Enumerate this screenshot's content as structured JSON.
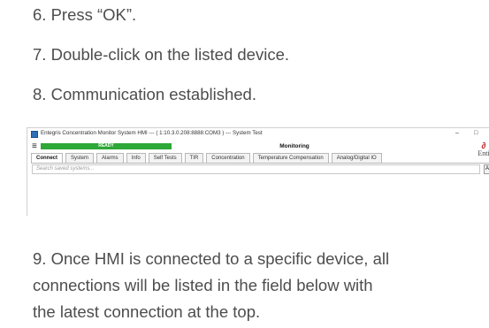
{
  "steps": [
    {
      "number": "6.",
      "text": "Press “OK”."
    },
    {
      "number": "7.",
      "text": "Double-click on the listed device."
    },
    {
      "number": "8.",
      "text": "Communication established."
    },
    {
      "number": "9.",
      "lines": [
        "Once HMI is connected to a specific device, all",
        "connections will be listed in the field below with",
        "the latest connection at the top."
      ]
    }
  ],
  "screenshot": {
    "window_title": "Entegris Concentration Monitor System HMI --- ( 1:10.3.0.208:8888:COM3 ) --- System Test",
    "minimize_glyph": "–",
    "maximize_glyph": "□",
    "menu_glyph": "≡",
    "status": "READY",
    "status_color": "#2ea836",
    "mode": "Monitoring",
    "logo_text": "Enti",
    "logo_color": "#c0272d",
    "tabs": [
      "Connect",
      "System",
      "Alarms",
      "Info",
      "Self Tests",
      "TIR",
      "Concentration",
      "Temperature Compensation",
      "Analog/Digital IO"
    ],
    "active_tab": "Connect",
    "search_placeholder": "Search saved systems...",
    "side_button_label": "Ac"
  }
}
